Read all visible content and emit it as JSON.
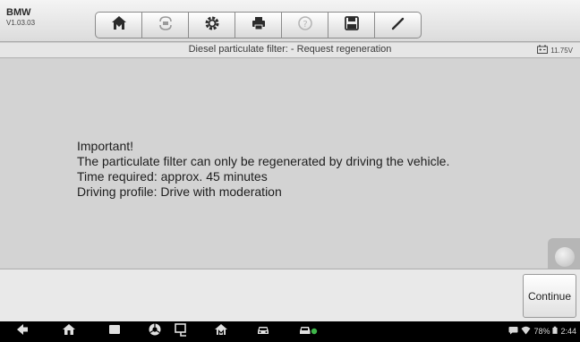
{
  "app": {
    "brand": "BMW",
    "version": "V1.03.03"
  },
  "toolbar": {
    "icons": [
      "home-icon",
      "vehicle-swap-icon",
      "settings-icon",
      "print-icon",
      "help-icon",
      "save-icon",
      "edit-icon"
    ]
  },
  "header": {
    "title": "Diesel particulate filter: - Request regeneration",
    "battery_voltage": "11.75V"
  },
  "message": {
    "line1": "Important!",
    "line2": "The particulate filter can only be regenerated by driving the vehicle.",
    "line3": "Time required: approx. 45 minutes",
    "line4": "Driving profile: Drive with moderation"
  },
  "actions": {
    "continue_label": "Continue"
  },
  "system_bar": {
    "battery_percent": "78%",
    "time": "2:44"
  },
  "colors": {
    "toolbar_border": "#8b8b8b",
    "content_bg": "#d3d3d3",
    "navbar_bg": "#000000"
  }
}
